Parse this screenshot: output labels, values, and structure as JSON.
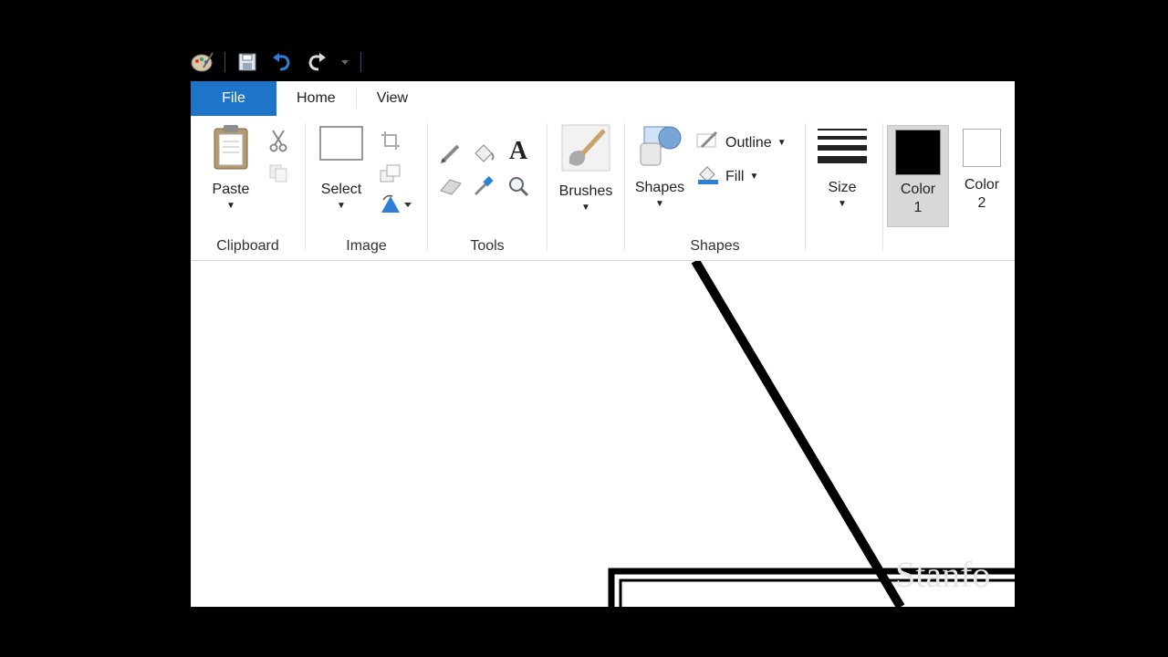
{
  "quick_access": {
    "icons": [
      "paint-app-icon",
      "save-icon",
      "undo-icon",
      "redo-icon",
      "customize-dropdown-icon"
    ]
  },
  "tabs": [
    {
      "label": "File"
    },
    {
      "label": "Home"
    },
    {
      "label": "View"
    }
  ],
  "ribbon": {
    "clipboard": {
      "group_label": "Clipboard",
      "paste_label": "Paste"
    },
    "image": {
      "group_label": "Image",
      "select_label": "Select"
    },
    "tools": {
      "group_label": "Tools"
    },
    "brushes": {
      "label": "Brushes"
    },
    "shapes": {
      "group_label": "Shapes",
      "shapes_label": "Shapes",
      "outline_label": "Outline",
      "fill_label": "Fill"
    },
    "size": {
      "label": "Size"
    },
    "colors": {
      "color1_label": "Color\n1",
      "color2_label": "Color\n2",
      "color1_value": "#000000",
      "color2_value": "#ffffff"
    }
  },
  "canvas_watermark": "Stanfo",
  "theme": {
    "accent": "#1e74c8",
    "canvas": "#ffffff",
    "stroke": "#000000"
  }
}
